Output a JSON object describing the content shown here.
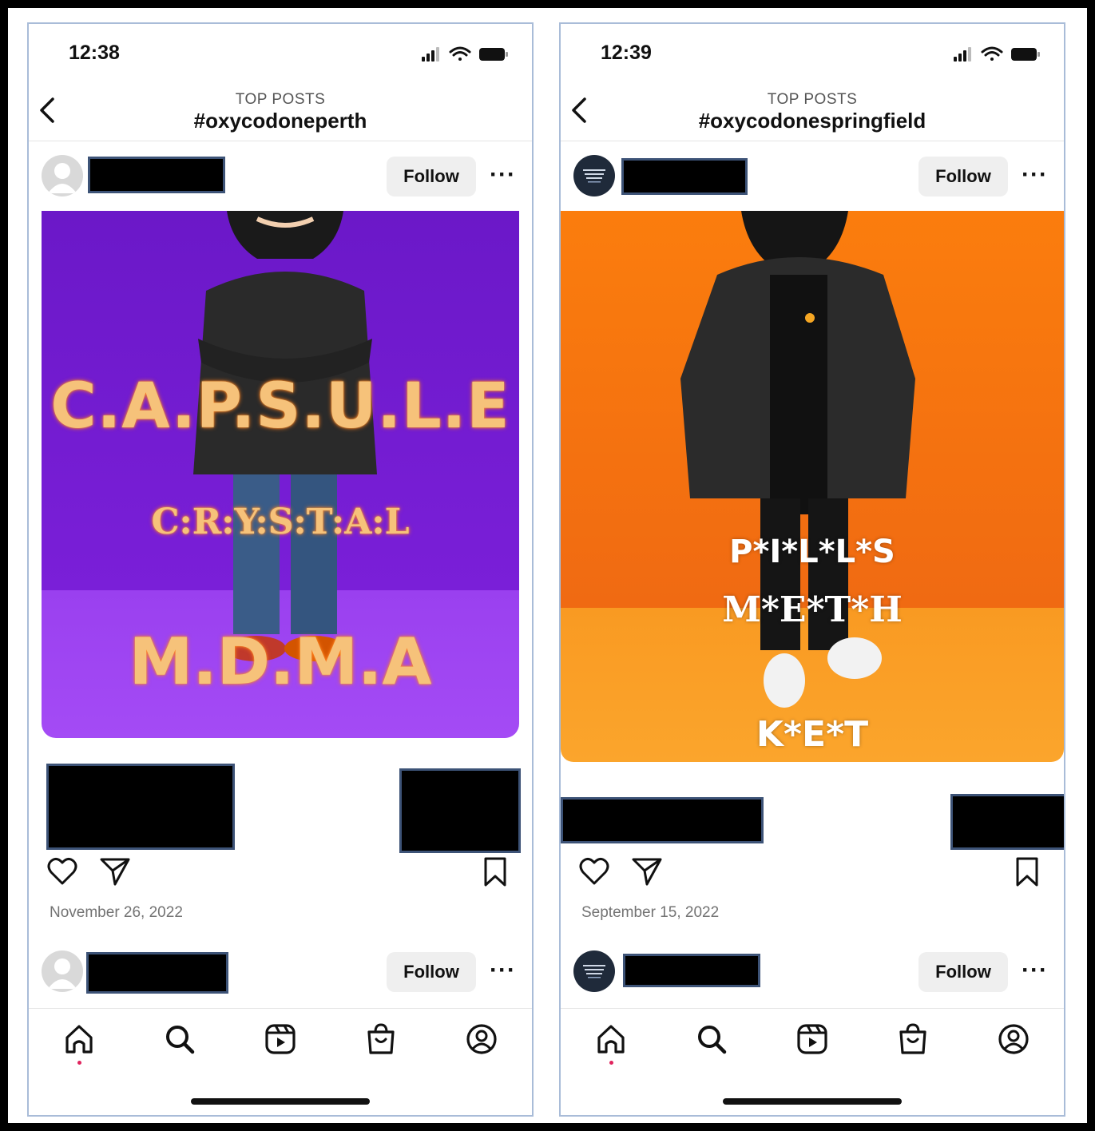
{
  "colors": {
    "accent_dot": "#e0245e",
    "redaction": "#000000",
    "redaction_border": "#3d5377",
    "image1_bg": "#7a1fd8",
    "image2_bg": "#f37512"
  },
  "phones": [
    {
      "status_time": "12:38",
      "header": {
        "section": "TOP POSTS",
        "hashtag": "#oxycodoneperth"
      },
      "posts": [
        {
          "follow_label": "Follow",
          "more_label": "···",
          "image_text": [
            "C.A.P.S.U.L.E",
            "C:R:Y:S:T:A:L",
            "M.D.M.A"
          ],
          "date": "November 26, 2022"
        },
        {
          "follow_label": "Follow",
          "more_label": "···"
        }
      ]
    },
    {
      "status_time": "12:39",
      "header": {
        "section": "TOP POSTS",
        "hashtag": "#oxycodonespringfield"
      },
      "posts": [
        {
          "follow_label": "Follow",
          "more_label": "···",
          "image_text": [
            "P*I*L*L*S",
            "M*E*T*H",
            "K*E*T"
          ],
          "date": "September 15, 2022"
        },
        {
          "follow_label": "Follow",
          "more_label": "···"
        }
      ]
    }
  ],
  "icons": [
    "back-icon",
    "signal-icon",
    "wifi-icon",
    "battery-icon",
    "heart-icon",
    "share-icon",
    "bookmark-icon",
    "home-icon",
    "search-icon",
    "reels-icon",
    "shop-icon",
    "profile-icon"
  ]
}
